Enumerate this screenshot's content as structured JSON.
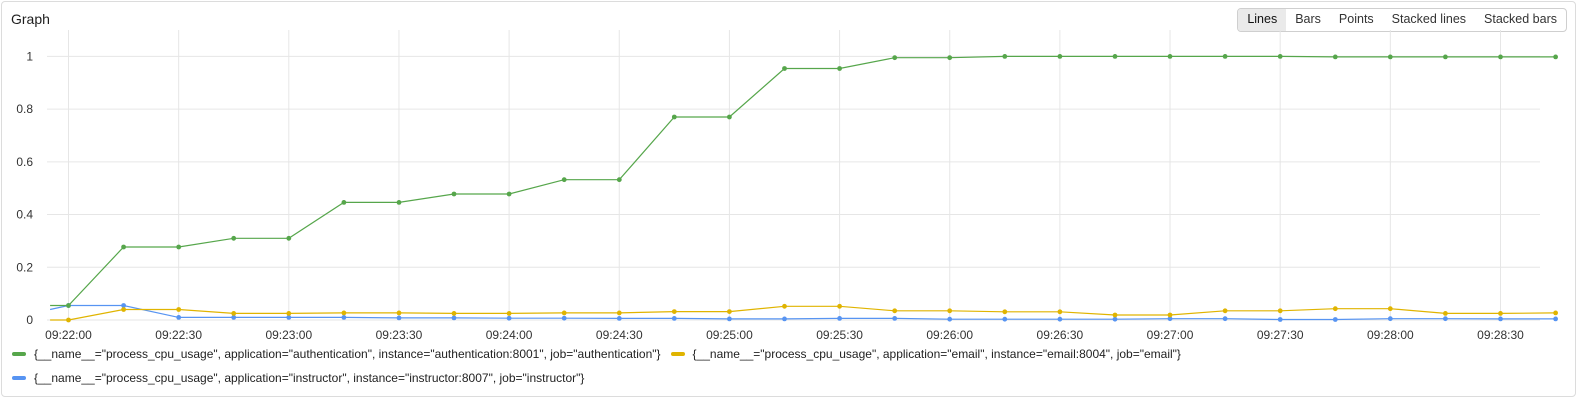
{
  "panel": {
    "title": "Graph"
  },
  "display_modes": [
    {
      "label": "Lines",
      "active": true
    },
    {
      "label": "Bars",
      "active": false
    },
    {
      "label": "Points",
      "active": false
    },
    {
      "label": "Stacked lines",
      "active": false
    },
    {
      "label": "Stacked bars",
      "active": false
    }
  ],
  "colors": {
    "authentication": "#56a64b",
    "email": "#e0b400",
    "instructor": "#5794f2",
    "grid": "#e6e6e6",
    "axis_text": "#333333"
  },
  "chart_data": {
    "type": "line",
    "title": "",
    "xlabel": "",
    "ylabel": "",
    "ylim": [
      0,
      1.1
    ],
    "x_ticks": [
      "09:22:00",
      "09:22:30",
      "09:23:00",
      "09:23:30",
      "09:24:00",
      "09:24:30",
      "09:25:00",
      "09:25:30",
      "09:26:00",
      "09:26:30",
      "09:27:00",
      "09:27:30",
      "09:28:00",
      "09:28:30"
    ],
    "y_ticks": [
      "0",
      "0.2",
      "0.4",
      "0.6",
      "0.8",
      "1"
    ],
    "y_tick_values": [
      0,
      0.2,
      0.4,
      0.6,
      0.8,
      1
    ],
    "x": [
      "09:21:55",
      "09:22:00",
      "09:22:15",
      "09:22:30",
      "09:22:45",
      "09:23:00",
      "09:23:15",
      "09:23:30",
      "09:23:45",
      "09:24:00",
      "09:24:15",
      "09:24:30",
      "09:24:45",
      "09:25:00",
      "09:25:15",
      "09:25:30",
      "09:25:45",
      "09:26:00",
      "09:26:15",
      "09:26:30",
      "09:26:45",
      "09:27:00",
      "09:27:15",
      "09:27:30",
      "09:27:45",
      "09:28:00",
      "09:28:15",
      "09:28:30",
      "09:28:45"
    ],
    "grid": true,
    "legend_position": "bottom",
    "series": [
      {
        "name": "{__name__=\"process_cpu_usage\", application=\"authentication\", instance=\"authentication:8001\", job=\"authentication\"}",
        "color_key": "authentication",
        "values": [
          0.055,
          0.055,
          0.277,
          0.277,
          0.31,
          0.31,
          0.446,
          0.446,
          0.478,
          0.478,
          0.532,
          0.532,
          0.77,
          0.77,
          0.954,
          0.954,
          0.995,
          0.995,
          1.0,
          1.0,
          1.0,
          1.0,
          1.0,
          1.0,
          0.998,
          0.998,
          0.998,
          0.998,
          0.998
        ]
      },
      {
        "name": "{__name__=\"process_cpu_usage\", application=\"email\", instance=\"email:8004\", job=\"email\"}",
        "color_key": "email",
        "values": [
          0.0,
          0.0,
          0.04,
          0.04,
          0.025,
          0.025,
          0.027,
          0.027,
          0.025,
          0.025,
          0.027,
          0.027,
          0.032,
          0.032,
          0.052,
          0.052,
          0.035,
          0.035,
          0.031,
          0.031,
          0.019,
          0.019,
          0.035,
          0.035,
          0.043,
          0.043,
          0.025,
          0.025,
          0.027
        ]
      },
      {
        "name": "{__name__=\"process_cpu_usage\", application=\"instructor\", instance=\"instructor:8007\", job=\"instructor\"}",
        "color_key": "instructor",
        "values": [
          0.04,
          0.055,
          0.055,
          0.01,
          0.01,
          0.01,
          0.01,
          0.008,
          0.008,
          0.007,
          0.007,
          0.006,
          0.006,
          0.004,
          0.004,
          0.006,
          0.006,
          0.003,
          0.003,
          0.003,
          0.003,
          0.005,
          0.005,
          0.002,
          0.002,
          0.005,
          0.005,
          0.004,
          0.004
        ]
      }
    ]
  }
}
